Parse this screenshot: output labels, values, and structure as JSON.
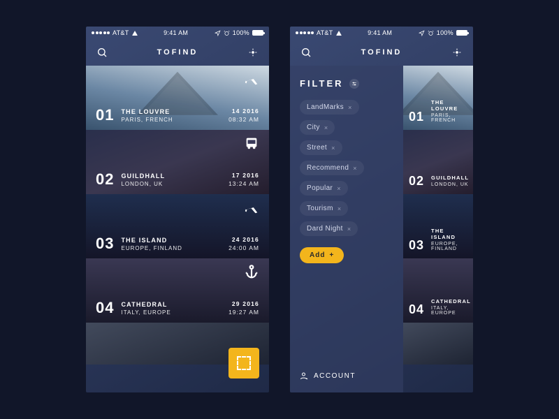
{
  "status": {
    "carrier": "AT&T",
    "time": "9:41 AM",
    "battery": "100%"
  },
  "nav": {
    "title": "TOFIND"
  },
  "cards": [
    {
      "idx": "01",
      "name": "THE LOUVRE",
      "loc": "PARIS, FRENCH",
      "date": "14 2016",
      "time": "08:32 AM",
      "transport": "plane",
      "bg": "bg-louvre"
    },
    {
      "idx": "02",
      "name": "GUILDHALL",
      "loc": "LONDON, UK",
      "date": "17 2016",
      "time": "13:24 AM",
      "transport": "bus",
      "bg": "bg-guild"
    },
    {
      "idx": "03",
      "name": "THE ISLAND",
      "loc": "EUROPE, FINLAND",
      "date": "24 2016",
      "time": "24:00 AM",
      "transport": "plane",
      "bg": "bg-island"
    },
    {
      "idx": "04",
      "name": "CATHEDRAL",
      "loc": "ITALY, EUROPE",
      "date": "29 2016",
      "time": "19:27 AM",
      "transport": "anchor",
      "bg": "bg-cath"
    }
  ],
  "filter": {
    "title": "FILTER",
    "chips": [
      "LandMarks",
      "City",
      "Street",
      "Recommend",
      "Popular",
      "Tourism",
      "Dard Night"
    ],
    "add_label": "Add",
    "account_label": "ACCOUNT"
  }
}
